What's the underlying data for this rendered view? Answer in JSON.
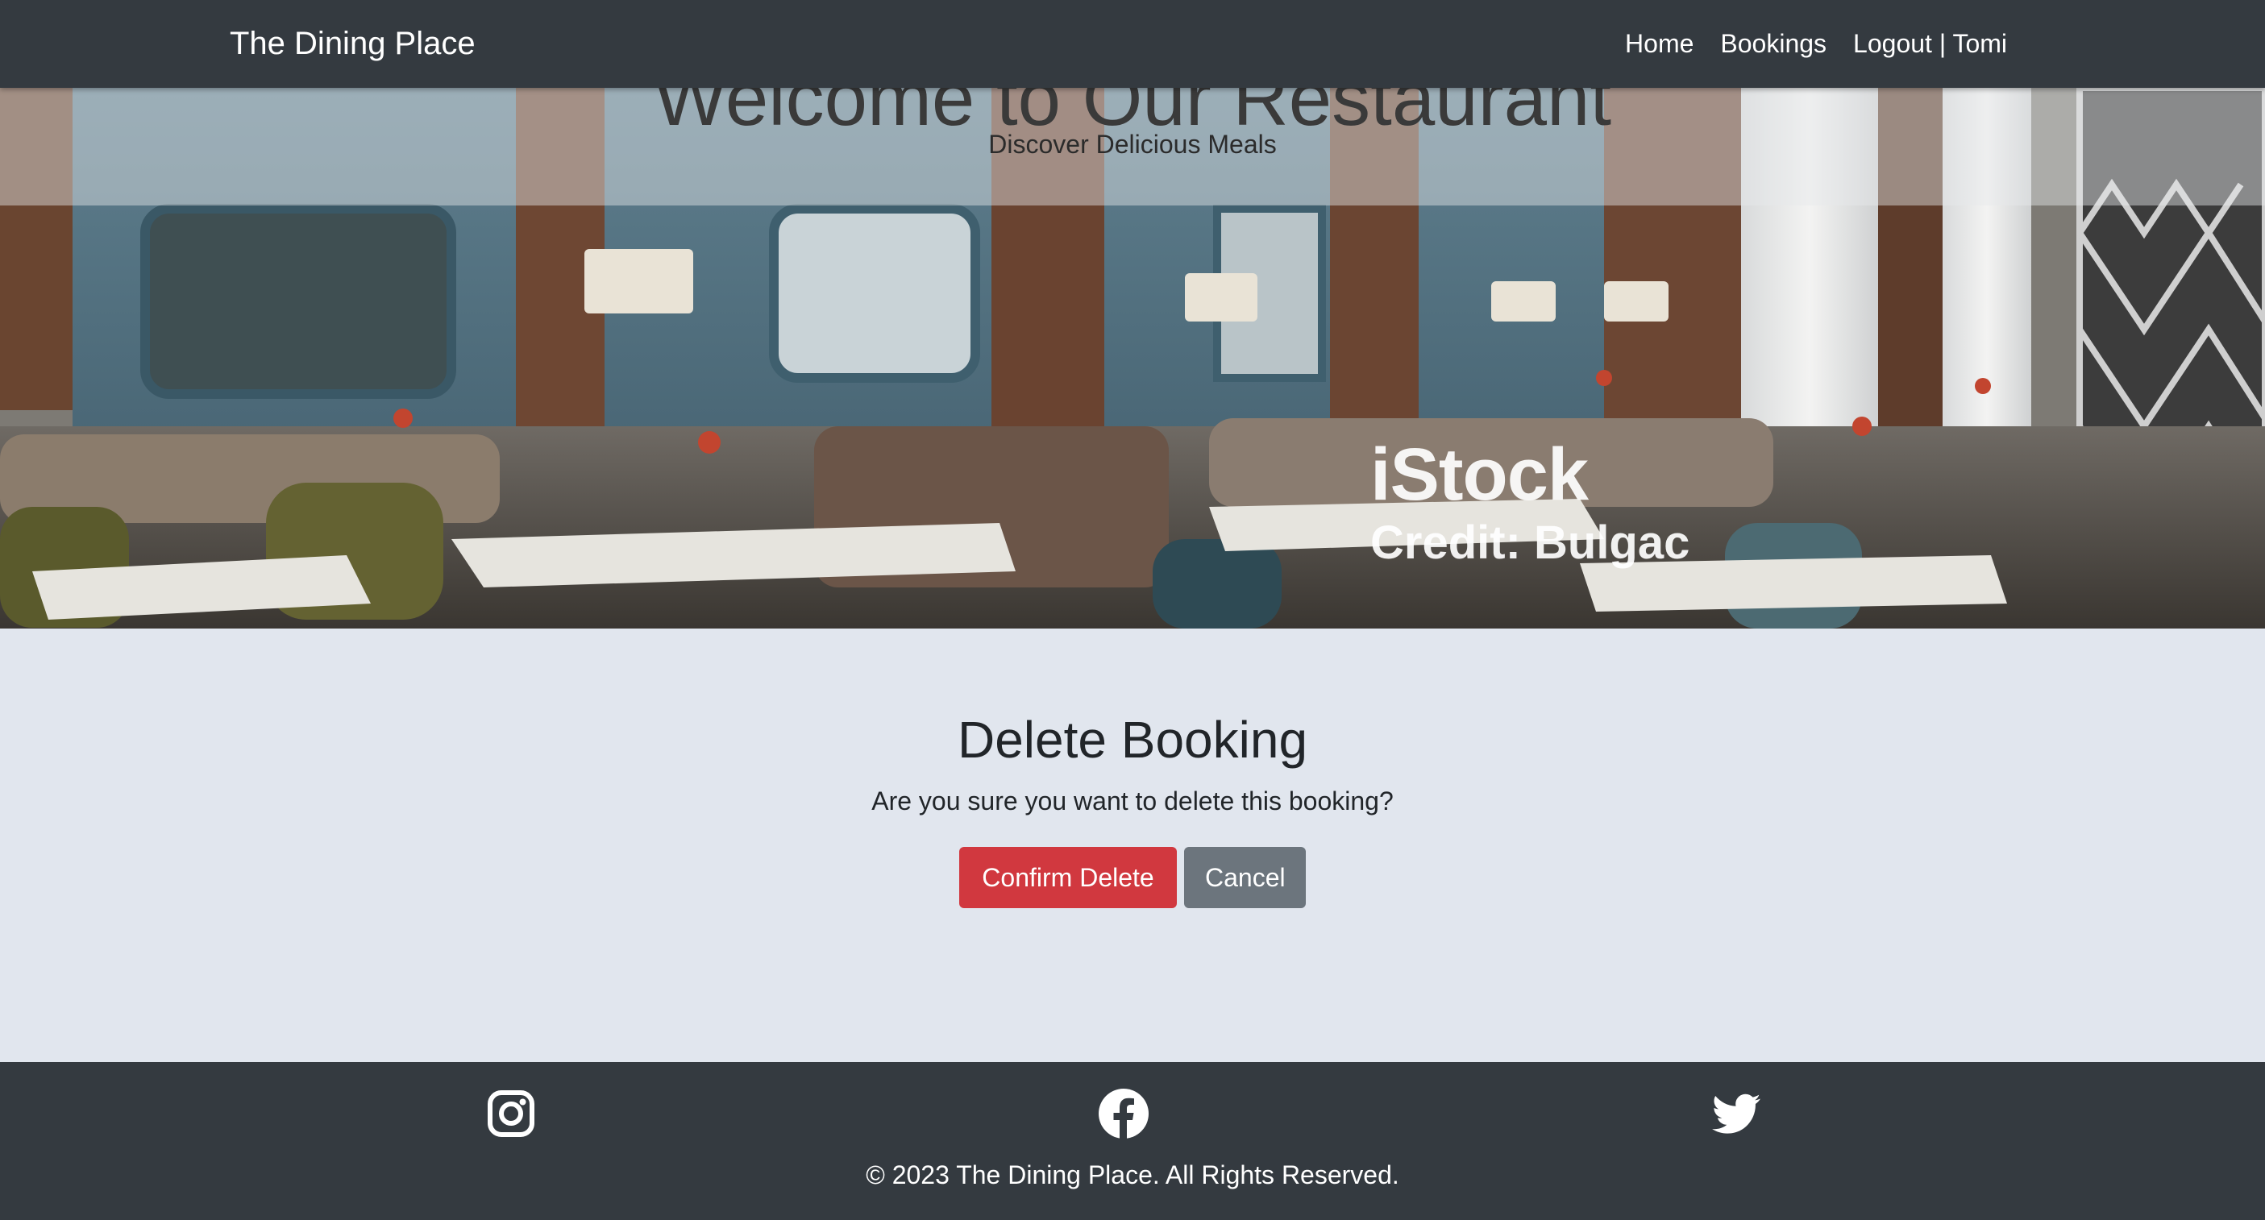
{
  "navbar": {
    "brand": "The Dining Place",
    "links": {
      "home": "Home",
      "bookings": "Bookings",
      "logout": "Logout | Tomi"
    }
  },
  "hero": {
    "title": "Welcome to Our Restaurant",
    "subtitle": "Discover Delicious Meals",
    "watermark_brand": "iStock",
    "watermark_credit": "Credit: Bulgac"
  },
  "main": {
    "heading": "Delete Booking",
    "question": "Are you sure you want to delete this booking?",
    "confirm_label": "Confirm Delete",
    "cancel_label": "Cancel"
  },
  "footer": {
    "icons": [
      "instagram-icon",
      "facebook-icon",
      "twitter-icon"
    ],
    "copyright": "© 2023 The Dining Place. All Rights Reserved."
  },
  "colors": {
    "navbar_bg": "#343a40",
    "page_bg": "#e1e6ee",
    "danger": "#d1383f",
    "secondary": "#6c757d"
  }
}
